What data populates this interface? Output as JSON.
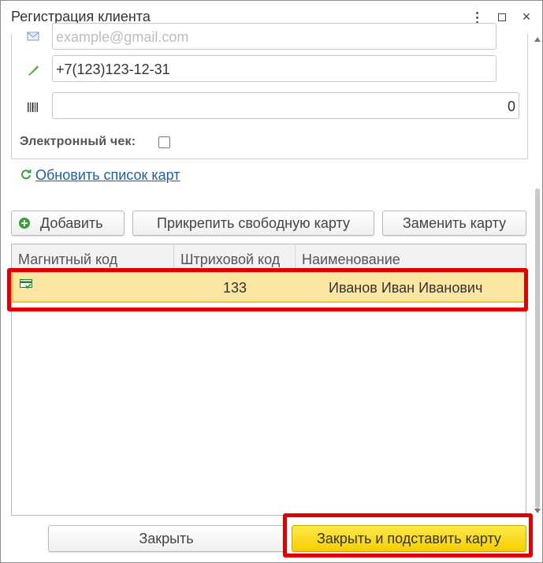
{
  "window": {
    "title": "Регистрация клиента",
    "menu_icon": "kebab-menu-icon",
    "maximize_icon": "maximize-icon",
    "close_icon": "close-icon",
    "close_glyph": "×"
  },
  "form": {
    "email": {
      "icon": "email-icon",
      "placeholder": "example@gmail.com"
    },
    "phone": {
      "icon": "phone-icon",
      "value": "+7(123)123-12-31"
    },
    "barcode": {
      "icon": "barcode-icon",
      "value": "0"
    },
    "electronic_receipt": {
      "label": "Электронный чек:",
      "checked": false
    }
  },
  "refresh_link": {
    "icon": "refresh-icon",
    "label": "Обновить список карт"
  },
  "toolbar": {
    "add_label": "Добавить",
    "attach_label": "Прикрепить свободную карту",
    "replace_label": "Заменить карту"
  },
  "table": {
    "columns": [
      "Магнитный код",
      "Штриховой код",
      "Наименование"
    ],
    "rows": [
      {
        "icon": "card-icon",
        "magnetic_code": "",
        "barcode": "133",
        "name": "Иванов Иван Иванович"
      }
    ]
  },
  "footer": {
    "close_label": "Закрыть",
    "close_insert_label": "Закрыть и подставить карту"
  },
  "colors": {
    "selected_row": "#fbe7a1",
    "primary_button": "#f5cf00",
    "highlight": "#e00000",
    "link": "#1f5fa8"
  }
}
